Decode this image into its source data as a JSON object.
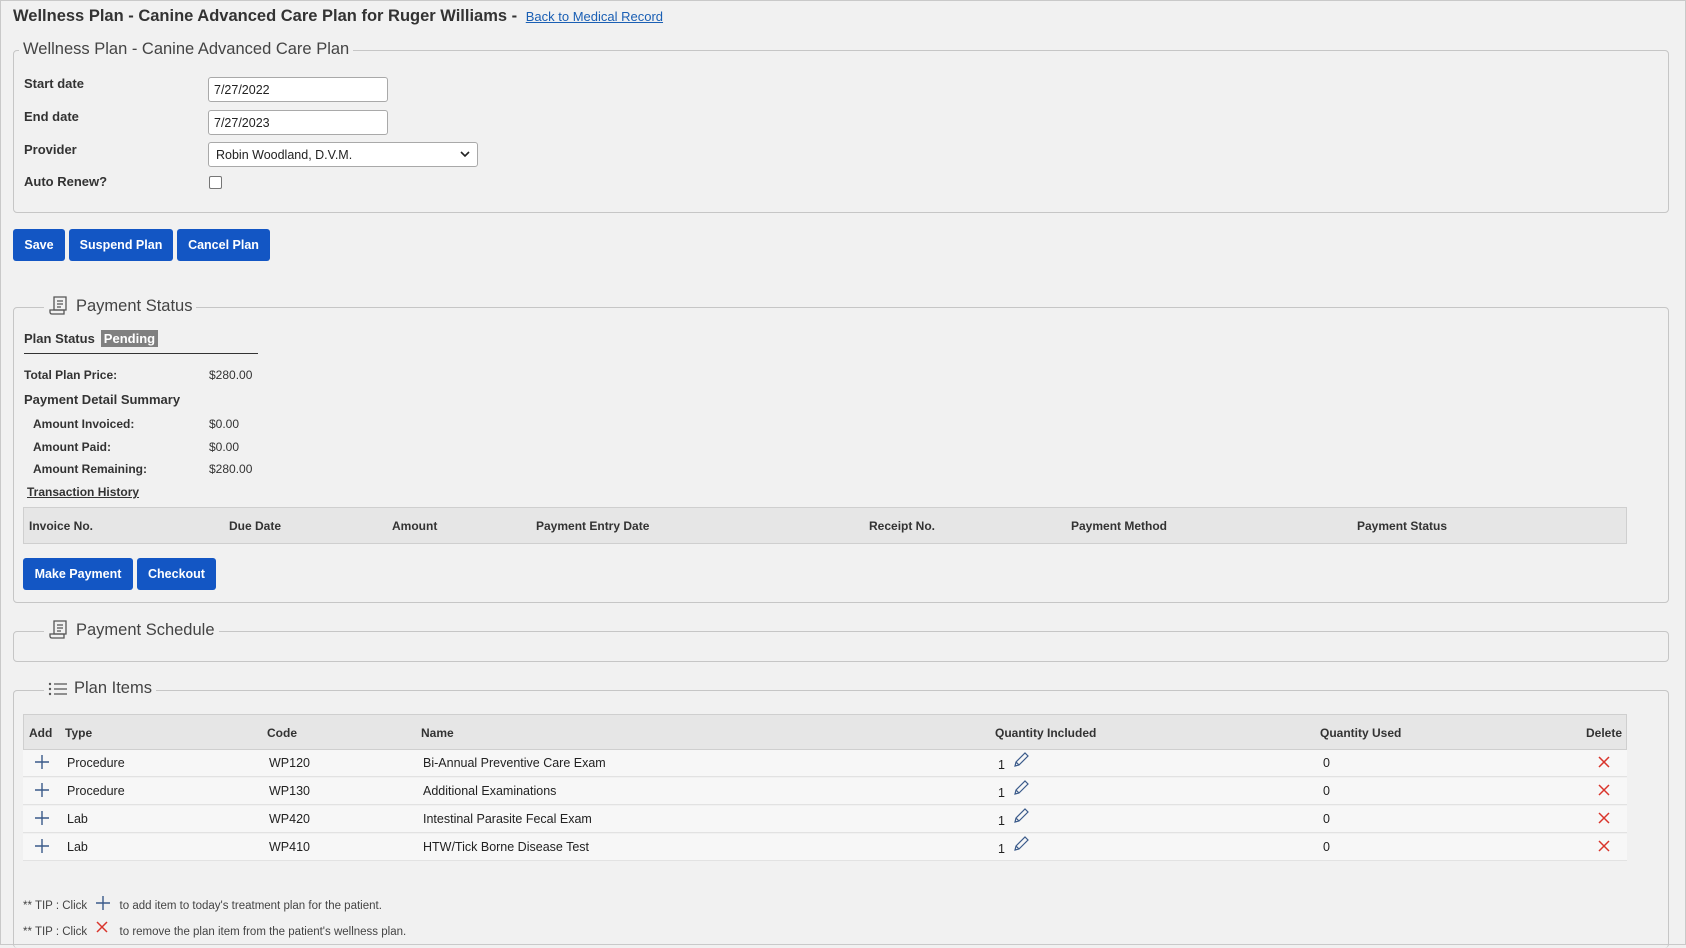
{
  "header": {
    "title": "Wellness Plan - Canine Advanced Care Plan for Ruger Williams -",
    "back_link": "Back to Medical Record"
  },
  "plan": {
    "legend": "Wellness Plan - Canine Advanced Care Plan",
    "start_label": "Start date",
    "start_value": "7/27/2022",
    "end_label": "End date",
    "end_value": "7/27/2023",
    "provider_label": "Provider",
    "provider_value": "Robin Woodland, D.V.M.",
    "auto_renew_label": "Auto Renew?",
    "auto_renew_checked": false
  },
  "actions": {
    "save": "Save",
    "suspend": "Suspend Plan",
    "cancel": "Cancel Plan"
  },
  "payment_status": {
    "legend": "Payment Status",
    "plan_status_label": "Plan Status",
    "plan_status_value": "Pending",
    "total_price_label": "Total Plan Price:",
    "total_price_value": "$280.00",
    "summary_label": "Payment Detail Summary",
    "invoiced_label": "Amount Invoiced:",
    "invoiced_value": "$0.00",
    "paid_label": "Amount Paid:",
    "paid_value": "$0.00",
    "remaining_label": "Amount Remaining:",
    "remaining_value": "$280.00",
    "history_link": "Transaction History",
    "columns": [
      "Invoice No.",
      "Due Date",
      "Amount",
      "Payment Entry Date",
      "Receipt No.",
      "Payment Method",
      "Payment Status"
    ],
    "make_payment": "Make Payment",
    "checkout": "Checkout"
  },
  "payment_schedule": {
    "legend": "Payment Schedule"
  },
  "plan_items": {
    "legend": "Plan Items",
    "columns": [
      "Add",
      "Type",
      "Code",
      "Name",
      "Quantity Included",
      "Quantity Used",
      "Delete"
    ],
    "rows": [
      {
        "type": "Procedure",
        "code": "WP120",
        "name": "Bi-Annual Preventive Care Exam",
        "qty_included": "1",
        "qty_used": "0"
      },
      {
        "type": "Procedure",
        "code": "WP130",
        "name": "Additional Examinations",
        "qty_included": "1",
        "qty_used": "0"
      },
      {
        "type": "Lab",
        "code": "WP420",
        "name": "Intestinal Parasite Fecal Exam",
        "qty_included": "1",
        "qty_used": "0"
      },
      {
        "type": "Lab",
        "code": "WP410",
        "name": "HTW/Tick Borne Disease Test",
        "qty_included": "1",
        "qty_used": "0"
      }
    ]
  },
  "tips": {
    "prefix": "** TIP : Click",
    "add_text": "to add item to today's treatment plan for the patient.",
    "remove_text": "to remove the plan item from the patient's wellness plan."
  },
  "colors": {
    "primary_button": "#1356c4",
    "badge": "#808080",
    "delete_icon": "#d9342b",
    "link": "#1a5fb4"
  }
}
